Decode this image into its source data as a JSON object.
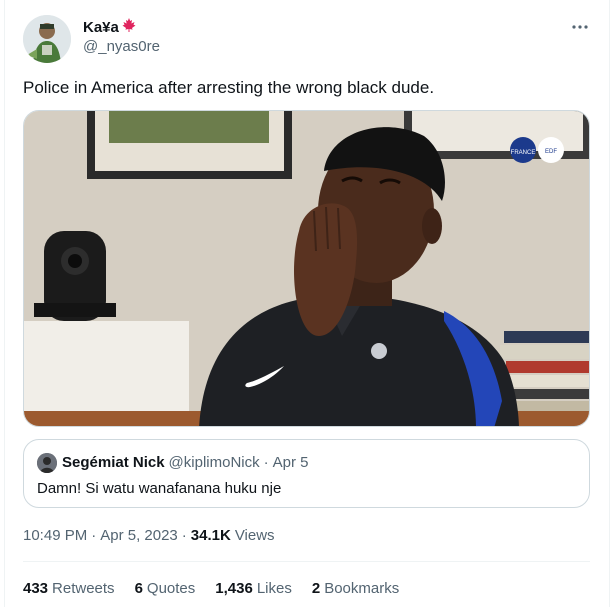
{
  "author": {
    "display_name": "Ka¥a",
    "handle": "@_nyas0re"
  },
  "tweet": {
    "text": "Police in America after arresting the wrong black dude."
  },
  "media": {
    "badge_1": "FRANCE",
    "badge_2": "EDF"
  },
  "quote": {
    "name": "Segémiat Nick",
    "handle": "@kiplimoNick",
    "separator": "·",
    "date": "Apr 5",
    "text": "Damn! Si watu wanafanana huku nje"
  },
  "meta": {
    "time": "10:49 PM",
    "separator": "·",
    "date": "Apr 5, 2023",
    "separator2": "·",
    "views_count": "34.1K",
    "views_label": "Views"
  },
  "stats": {
    "retweets_count": "433",
    "retweets_label": "Retweets",
    "quotes_count": "6",
    "quotes_label": "Quotes",
    "likes_count": "1,436",
    "likes_label": "Likes",
    "bookmarks_count": "2",
    "bookmarks_label": "Bookmarks"
  },
  "colors": {
    "maple_leaf": "#e0245e",
    "muted": "#536471",
    "border": "#cfd9de"
  },
  "icons": {
    "more": "more-horizontal-icon",
    "flag": "maple-leaf-icon"
  }
}
